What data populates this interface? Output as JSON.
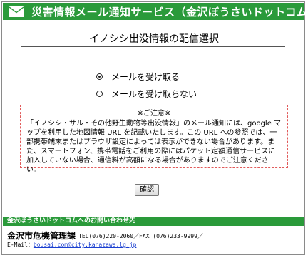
{
  "header": {
    "title": "災害情報メール通知サービス（金沢ぼうさいドットコム）"
  },
  "page": {
    "title": "イノシシ出没情報の配信選択"
  },
  "options": [
    {
      "label": "メールを受け取る",
      "selected": true
    },
    {
      "label": "メールを受け取らない",
      "selected": false
    }
  ],
  "notice": {
    "heading": "※ご注意※",
    "body": "「イノシシ・サル・その他野生動物等出没情報」のメール通知には、google マップを利用した地図情報 URL を記載いたします。この URL への参照では、一部携帯端末またはブラウザ設定によっては表示ができない場合があります。また、スマートフォン、携帯電話をご利用の際にはパケット定額通信サービスに加入していない場合、通信料が高額になる場合がありますのでご注意ください。"
  },
  "confirm_button": "確認",
  "footer": {
    "bar_text": "金沢ぼうさいドットコムへのお問い合わせ先",
    "department": "金沢市危機管理課",
    "tel_fax": "TEL(076)220-2060／FAX (076)233-9999／",
    "email_label": "E-Mail：",
    "email": "bousai.com@city.kanazawa.lg.jp"
  },
  "colors": {
    "header_green": "#2a9a3a",
    "notice_border": "#e15a5a",
    "link_blue": "#1a3fd0"
  }
}
